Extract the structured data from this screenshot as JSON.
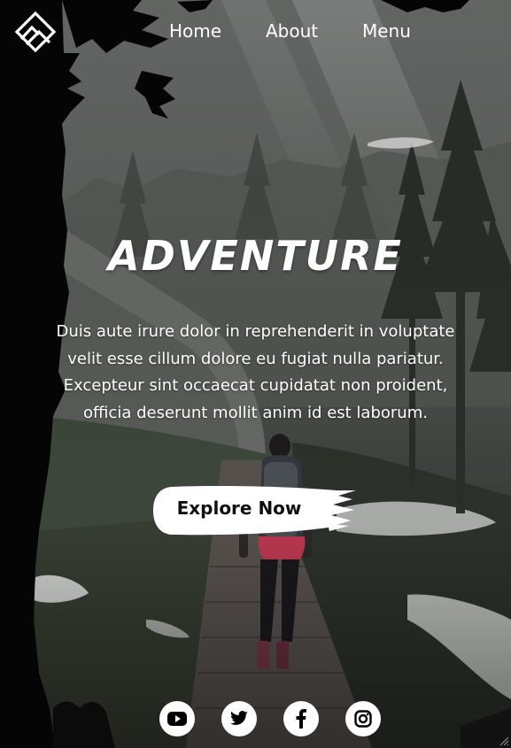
{
  "nav": {
    "logo_icon": "diamond-mountain-logo-icon",
    "links": [
      "Home",
      "About",
      "Menu"
    ]
  },
  "hero": {
    "title": "ADVENTURE",
    "text": "Duis aute irure dolor in reprehenderit in voluptate velit esse cillum dolore eu fugiat nulla pariatur. Excepteur sint occaecat cupidatat non proident, officia deserunt mollit anim id est laborum.",
    "cta_label": "Explore Now"
  },
  "social": {
    "icons": [
      "youtube-icon",
      "twitter-icon",
      "facebook-icon",
      "instagram-icon"
    ]
  },
  "colors": {
    "text": "#ffffff",
    "button_bg": "#ffffff",
    "button_text": "#111111",
    "tree_silhouette": "#050505"
  }
}
